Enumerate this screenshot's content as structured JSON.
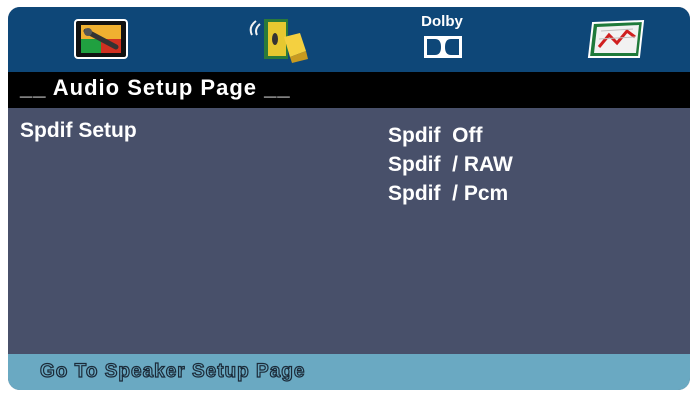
{
  "top_tabs": {
    "items": [
      {
        "id": "general",
        "icon": "tv-settings-icon"
      },
      {
        "id": "audio",
        "icon": "speaker-audio-icon"
      },
      {
        "id": "dolby",
        "icon": "dolby-digital-icon",
        "label": "Dolby"
      },
      {
        "id": "preference",
        "icon": "chart-preference-icon"
      }
    ]
  },
  "header": {
    "title": "__ Audio Setup Page __"
  },
  "setting": {
    "label": "Spdif Setup",
    "options": [
      "Spdif  Off",
      "Spdif  / RAW",
      "Spdif  / Pcm"
    ]
  },
  "footer": {
    "text": "Go To Speaker Setup Page"
  },
  "colors": {
    "icon_bar": "#0e4778",
    "background": "#48506a",
    "header_band": "#000000",
    "footer": "#6aa9c2",
    "text": "#ffffff"
  }
}
